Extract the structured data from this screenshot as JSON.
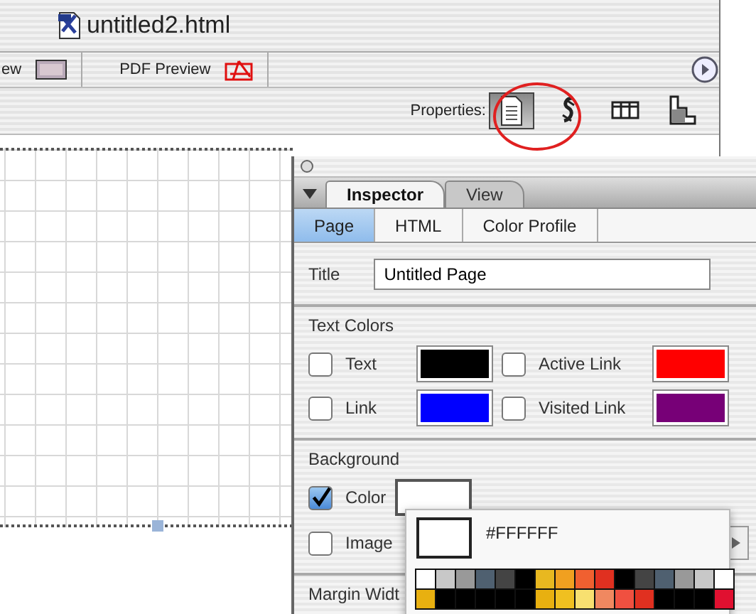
{
  "document_window": {
    "title": "untitled2.html",
    "toolbar_items": [
      {
        "kind": "preview",
        "label": "ew"
      },
      {
        "kind": "pdf",
        "label": "PDF Preview"
      }
    ],
    "properties_label": "Properties:",
    "property_buttons": [
      {
        "kind": "page",
        "selected": true
      },
      {
        "kind": "link",
        "selected": false
      },
      {
        "kind": "table",
        "selected": false
      },
      {
        "kind": "layout",
        "selected": false
      }
    ]
  },
  "inspector": {
    "tabs": [
      {
        "label": "Inspector",
        "selected": true
      },
      {
        "label": "View",
        "selected": false
      }
    ],
    "subtabs": [
      {
        "label": "Page",
        "selected": true
      },
      {
        "label": "HTML",
        "selected": false
      },
      {
        "label": "Color Profile",
        "selected": false
      }
    ],
    "title_label": "Title",
    "title_value": "Untitled Page",
    "text_colors": {
      "heading": "Text Colors",
      "items": [
        {
          "label": "Text",
          "checked": false,
          "color": "#000000"
        },
        {
          "label": "Active Link",
          "checked": false,
          "color": "#ff0000"
        },
        {
          "label": "Link",
          "checked": false,
          "color": "#0000ff"
        },
        {
          "label": "Visited Link",
          "checked": false,
          "color": "#770077"
        }
      ]
    },
    "background": {
      "heading": "Background",
      "items": [
        {
          "kind": "color",
          "label": "Color",
          "checked": true,
          "color": "#ffffff"
        },
        {
          "kind": "image",
          "label": "Image",
          "checked": false
        }
      ]
    },
    "margin_label": "Margin Widt"
  },
  "color_popup": {
    "hex": "#FFFFFF",
    "color": "#ffffff",
    "palette": [
      [
        {
          "color": "#ffffff"
        },
        {
          "color": "#c8c8c8"
        },
        {
          "color": "#999999"
        },
        {
          "color": "#4f6070"
        },
        {
          "color": "#444444"
        },
        {
          "color": "#000000"
        },
        {
          "color": "#e8b820"
        },
        {
          "color": "#f0a020"
        },
        {
          "color": "#f06030"
        },
        {
          "color": "#e03020"
        },
        {
          "color": "#000000"
        },
        {
          "color": "#444444"
        },
        {
          "color": "#4f6070"
        },
        {
          "color": "#999999"
        },
        {
          "color": "#c8c8c8"
        },
        {
          "color": "#ffffff"
        }
      ],
      [
        {
          "color": "#e8b010"
        },
        {
          "color": "#000000"
        },
        {
          "color": "#000000"
        },
        {
          "color": "#000000"
        },
        {
          "color": "#000000"
        },
        {
          "color": "#000000"
        },
        {
          "color": "#e8b010"
        },
        {
          "color": "#f0c020"
        },
        {
          "color": "#f8e070"
        },
        {
          "color": "#f08860"
        },
        {
          "color": "#f05040"
        },
        {
          "color": "#e03020"
        },
        {
          "color": "#000000"
        },
        {
          "color": "#000000"
        },
        {
          "color": "#000000"
        },
        {
          "color": "#e01030"
        }
      ]
    ]
  }
}
